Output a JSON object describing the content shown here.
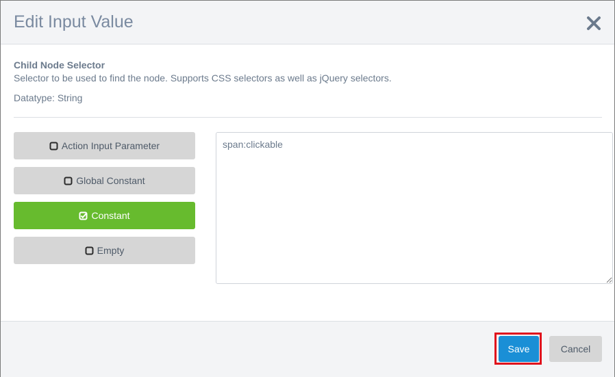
{
  "dialog": {
    "title": "Edit Input Value",
    "close_icon": "close-icon"
  },
  "field": {
    "name": "Child Node Selector",
    "description": "Selector to be used to find the node. Supports CSS selectors as well as jQuery selectors.",
    "datatype": "Datatype: String"
  },
  "options": [
    {
      "label": "Action Input Parameter",
      "selected": false,
      "icon": "checkbox-unchecked-icon"
    },
    {
      "label": "Global Constant",
      "selected": false,
      "icon": "checkbox-unchecked-icon"
    },
    {
      "label": "Constant",
      "selected": true,
      "icon": "checkbox-checked-icon"
    },
    {
      "label": "Empty",
      "selected": false,
      "icon": "checkbox-unchecked-icon"
    }
  ],
  "value": "span:clickable",
  "footer": {
    "save_label": "Save",
    "cancel_label": "Cancel"
  },
  "colors": {
    "selected_option": "#67bb2e",
    "save_button": "#1a8fd6",
    "highlight_outline": "#e0101c"
  }
}
